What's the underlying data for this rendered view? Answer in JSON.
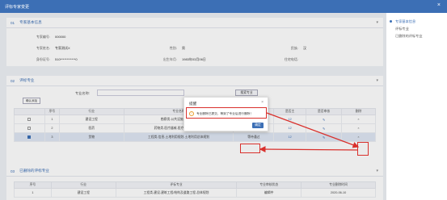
{
  "window": {
    "title": "评标专家变更",
    "close": "×"
  },
  "nav": {
    "items": [
      {
        "label": "专家基本信息"
      },
      {
        "label": "评标专业"
      },
      {
        "label": "已删除的评标专业"
      }
    ]
  },
  "basic": {
    "section_num": "01",
    "section_title": "专家基本信息",
    "fields": {
      "id_label": "专家编号:",
      "id_value": "000000",
      "name_label": "专家姓名:",
      "name_value": "专家测试X",
      "sex_label": "性别:",
      "sex_value": "男",
      "nation_label": "民族:",
      "nation_value": "汉",
      "idcard_label": "身份证号:",
      "idcard_value": "510************0",
      "birth_label": "出生年月:",
      "birth_value": "1983年03月06日",
      "home_label": "住宅电话:",
      "home_value": ""
    }
  },
  "major": {
    "section_num": "02",
    "section_title": "评标专业",
    "search_label": "专业名称:",
    "search_placeholder": "",
    "search_button": "搜索专业",
    "confirm_button": "确认添加",
    "columns": [
      "",
      "序号",
      "行业",
      "专业名称",
      "专业等级",
      "是否主",
      "是否审核",
      "删除"
    ],
    "rows": [
      {
        "checked": false,
        "no": "1",
        "industry": "建设工程",
        "major": "勘察类-公共设施-去掉勘察",
        "level": "",
        "main": "",
        "status": "",
        "delete": "×"
      },
      {
        "checked": false,
        "no": "2",
        "industry": "医药",
        "major": "药物类-医疗器械-医疗器械-手术器械",
        "level": "高级专家",
        "main": "",
        "status": "",
        "delete": "×"
      },
      {
        "checked": true,
        "no": "3",
        "industry": "货物",
        "major": "工程类-信息-土地利用规划-土地利用总体规划",
        "level": "等待通过",
        "main": "",
        "status": "",
        "delete": "×"
      }
    ]
  },
  "deleted": {
    "section_num": "03",
    "section_title": "已删除的评标专业",
    "columns": [
      "序号",
      "行业",
      "评标专业",
      "专业审核状态",
      "专业删除时间"
    ],
    "rows": [
      {
        "no": "1",
        "industry": "建设工程",
        "major": "工程类-建设-建筑工程/结构及道路工程-总体规划",
        "status": "编辑中",
        "time": "2020-06-10"
      }
    ]
  },
  "dialog": {
    "title": "提醒",
    "close": "×",
    "message": "专业删除已提交，等到了专业后进行删除！",
    "ok_label": "确定"
  }
}
